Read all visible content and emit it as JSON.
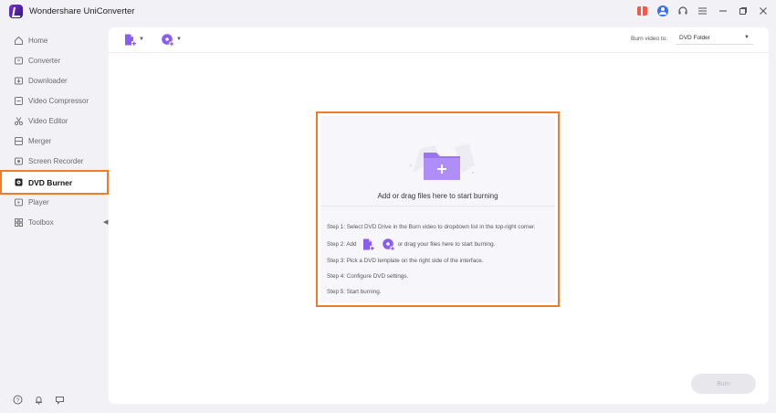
{
  "app": {
    "title": "Wondershare UniConverter"
  },
  "titlebar": {
    "icons": [
      "gift-icon",
      "account-icon",
      "headset-icon",
      "menu-icon",
      "minimize-icon",
      "maximize-icon",
      "close-icon"
    ]
  },
  "sidebar": {
    "items": [
      {
        "label": "Home",
        "icon": "home-icon"
      },
      {
        "label": "Converter",
        "icon": "converter-icon"
      },
      {
        "label": "Downloader",
        "icon": "downloader-icon"
      },
      {
        "label": "Video Compressor",
        "icon": "compress-icon"
      },
      {
        "label": "Video Editor",
        "icon": "scissors-icon"
      },
      {
        "label": "Merger",
        "icon": "merge-icon"
      },
      {
        "label": "Screen Recorder",
        "icon": "recorder-icon"
      },
      {
        "label": "DVD Burner",
        "icon": "dvd-icon",
        "active": true
      },
      {
        "label": "Player",
        "icon": "player-icon"
      },
      {
        "label": "Toolbox",
        "icon": "toolbox-icon"
      }
    ],
    "bottom_icons": [
      "help-icon",
      "bell-icon",
      "feedback-icon"
    ]
  },
  "toolbar": {
    "burn_video_to_label": "Burn video to:",
    "burn_target": "DVD Folder"
  },
  "dropzone": {
    "hint": "Add or drag files here to start burning",
    "steps": {
      "s1": "Step 1: Select DVD Drive in the Burn video to dropdown list in the top-right corner.",
      "s2_prefix": "Step 2: Add",
      "s2_suffix": "or drag your files here to start burning.",
      "s3": "Step 3: Pick a DVD template on the right side of the interface.",
      "s4": "Step 4: Configure DVD settings.",
      "s5": "Step 5: Start burning."
    }
  },
  "footer": {
    "burn_label": "Burn"
  },
  "colors": {
    "accent_purple": "#8a5cf0",
    "highlight_orange": "#f07c2a",
    "account_blue": "#3a6ff5",
    "gift_red": "#ef5a4f"
  }
}
